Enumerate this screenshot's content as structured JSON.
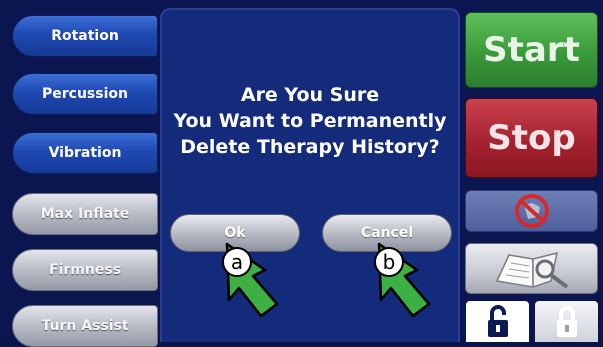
{
  "left_menu": {
    "rotation": "Rotation",
    "percussion": "Percussion",
    "vibration": "Vibration",
    "max_inflate": "Max Inflate",
    "firmness": "Firmness",
    "turn_assist": "Turn Assist"
  },
  "dialog": {
    "message": "Are You Sure\nYou Want to Permanently\nDelete Therapy History?",
    "ok_label": "Ok",
    "cancel_label": "Cancel"
  },
  "right_panel": {
    "start_label": "Start",
    "stop_label": "Stop",
    "no_silence_icon": "no-alarm-icon",
    "history_icon": "history-book-icon",
    "unlock_icon": "unlocked-padlock-icon",
    "lock_icon": "locked-padlock-icon"
  },
  "callouts": {
    "a": "a",
    "b": "b"
  },
  "colors": {
    "background": "#0b1650",
    "dialog_bg": "#142a7a",
    "start_green": "#3a9a3a",
    "stop_red": "#a52230",
    "callout_green": "#3cb043"
  }
}
